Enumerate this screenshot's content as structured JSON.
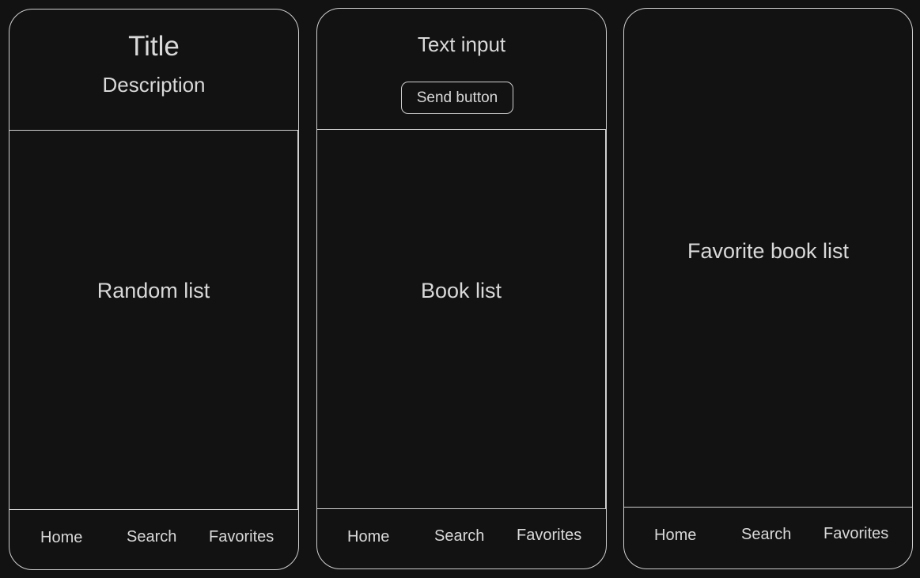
{
  "screens": [
    {
      "header": {
        "title": "Title",
        "description": "Description"
      },
      "content_label": "Random list",
      "nav": [
        "Home",
        "Search",
        "Favorites"
      ]
    },
    {
      "header": {
        "text_input": "Text input",
        "send_button": "Send button"
      },
      "content_label": "Book list",
      "nav": [
        "Home",
        "Search",
        "Favorites"
      ]
    },
    {
      "content_label": "Favorite book list",
      "nav": [
        "Home",
        "Search",
        "Favorites"
      ]
    }
  ]
}
